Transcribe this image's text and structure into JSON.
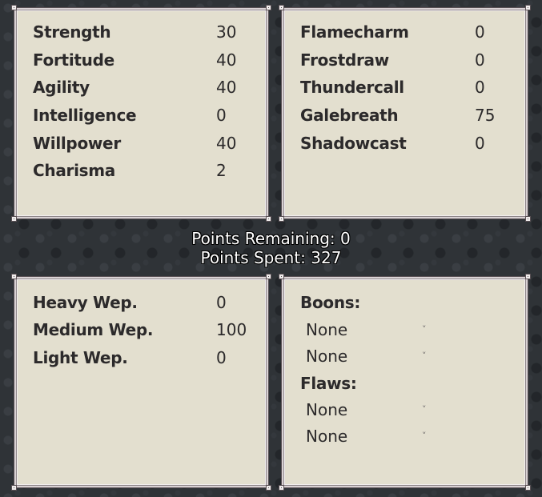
{
  "attributes": [
    {
      "label": "Strength",
      "value": "30"
    },
    {
      "label": "Fortitude",
      "value": "40"
    },
    {
      "label": "Agility",
      "value": "40"
    },
    {
      "label": "Intelligence",
      "value": "0"
    },
    {
      "label": "Willpower",
      "value": "40"
    },
    {
      "label": "Charisma",
      "value": "2"
    }
  ],
  "magic": [
    {
      "label": "Flamecharm",
      "value": "0"
    },
    {
      "label": "Frostdraw",
      "value": "0"
    },
    {
      "label": "Thundercall",
      "value": "0"
    },
    {
      "label": "Galebreath",
      "value": "75"
    },
    {
      "label": "Shadowcast",
      "value": "0"
    }
  ],
  "points": {
    "remaining": "Points Remaining: 0",
    "spent": "Points Spent: 327"
  },
  "weapons": [
    {
      "label": "Heavy Wep.",
      "value": "0"
    },
    {
      "label": "Medium Wep.",
      "value": "100"
    },
    {
      "label": "Light Wep.",
      "value": "0"
    }
  ],
  "traits": {
    "boons_label": "Boons:",
    "boons": [
      {
        "value": "None",
        "icon": "chevron-down-icon"
      },
      {
        "value": "None",
        "icon": "chevron-down-icon"
      }
    ],
    "flaws_label": "Flaws:",
    "flaws": [
      {
        "value": "None",
        "icon": "chevron-down-icon"
      },
      {
        "value": "None",
        "icon": "chevron-down-icon"
      }
    ],
    "chevron_glyph": "˅"
  }
}
